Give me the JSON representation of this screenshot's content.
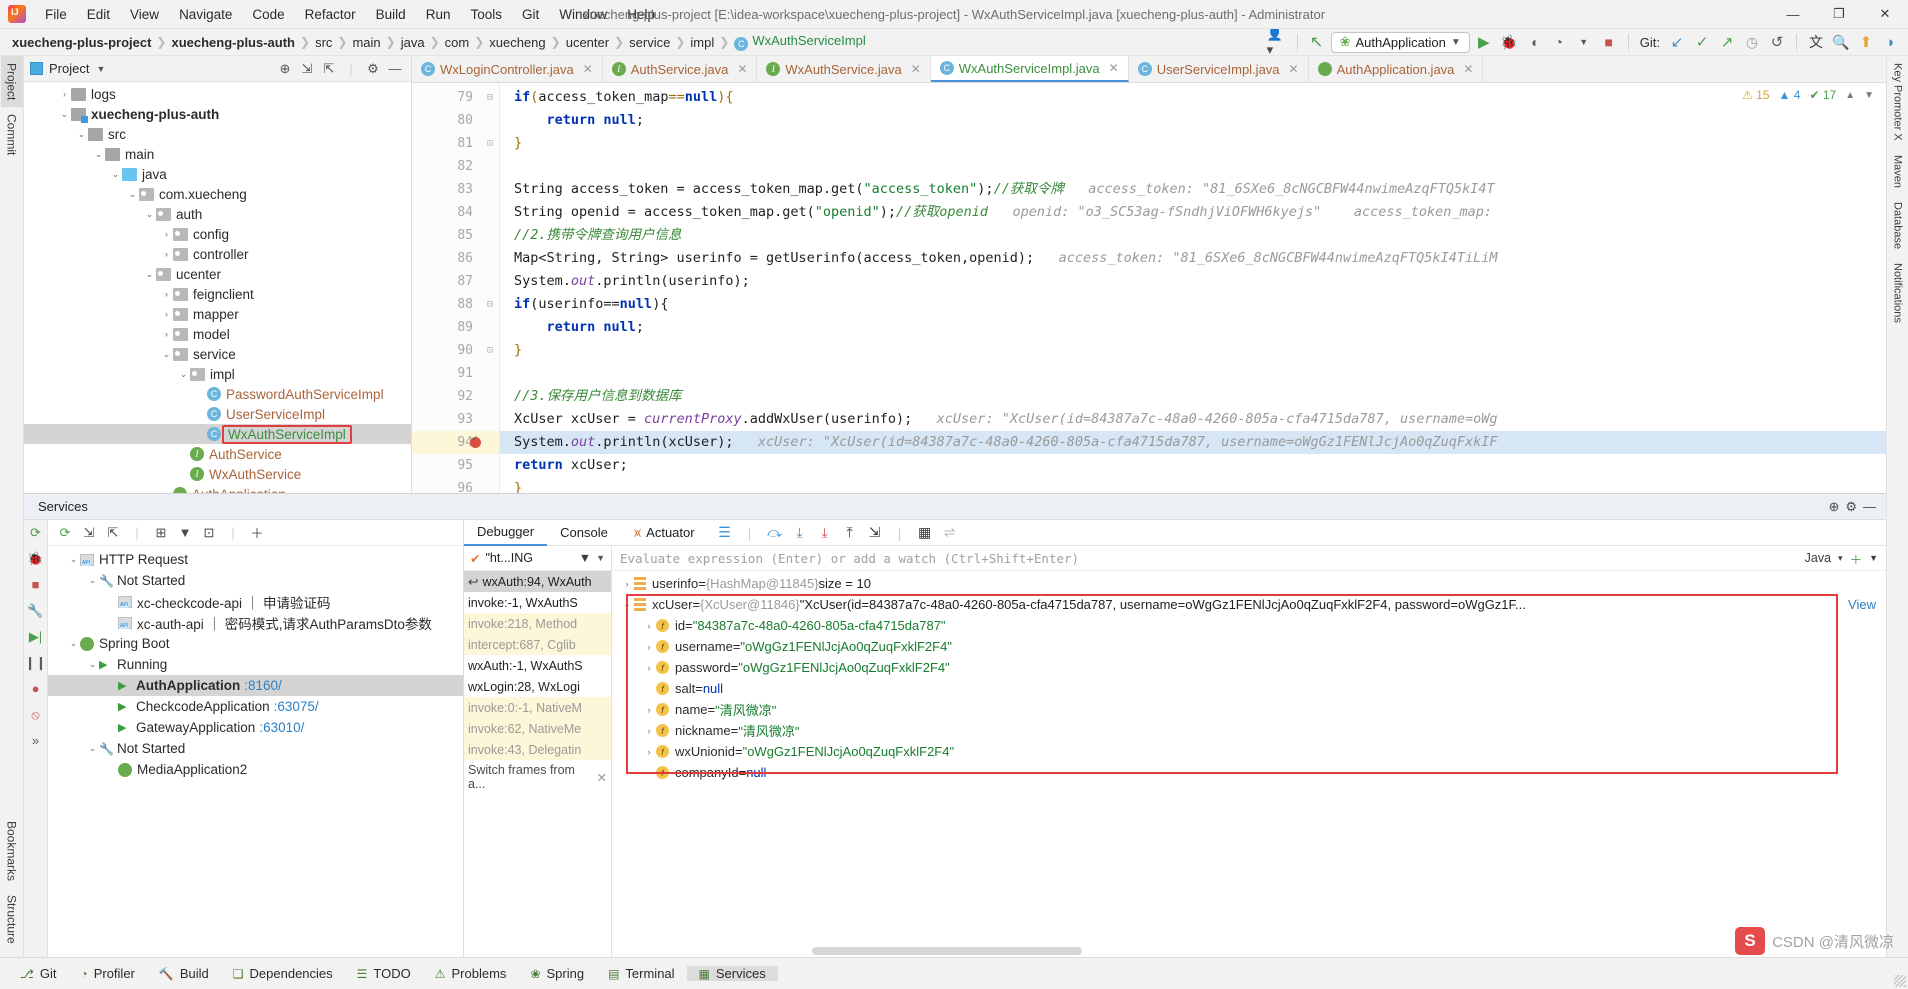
{
  "window": {
    "title": "xuecheng-plus-project [E:\\idea-workspace\\xuecheng-plus-project] - WxAuthServiceImpl.java [xuecheng-plus-auth] - Administrator",
    "minimize": "—",
    "maximize": "❐",
    "close": "✕"
  },
  "menu": [
    "File",
    "Edit",
    "View",
    "Navigate",
    "Code",
    "Refactor",
    "Build",
    "Run",
    "Tools",
    "Git",
    "Window",
    "Help"
  ],
  "breadcrumbs": [
    "xuecheng-plus-project",
    "xuecheng-plus-auth",
    "src",
    "main",
    "java",
    "com",
    "xuecheng",
    "ucenter",
    "service",
    "impl",
    "WxAuthServiceImpl"
  ],
  "toolbar": {
    "run_config": "AuthApplication",
    "git_label": "Git:",
    "icons": [
      "profile-icon",
      "back-icon",
      "run-icon",
      "debug-icon",
      "run-coverage-icon",
      "profiler-icon",
      "stop-icon",
      "update-project-icon",
      "commit-icon",
      "push-icon",
      "history-icon",
      "rollback-icon",
      "translate-icon",
      "search-everywhere-icon",
      "updates-icon",
      "ide-icon"
    ]
  },
  "left_rail": [
    "Project",
    "Commit"
  ],
  "left_rail_bottom": [
    "Bookmarks",
    "Structure"
  ],
  "right_rail": [
    "Key Promoter X",
    "Maven",
    "Database",
    "Notifications"
  ],
  "project": {
    "title": "Project",
    "tree": [
      {
        "label": "logs",
        "indent": 2,
        "arrow": "›",
        "icon": "folder",
        "style": "",
        "cut": true
      },
      {
        "label": "xuecheng-plus-auth",
        "indent": 2,
        "arrow": "⌄",
        "icon": "module",
        "style": "bold"
      },
      {
        "label": "src",
        "indent": 3,
        "arrow": "⌄",
        "icon": "folder",
        "style": ""
      },
      {
        "label": "main",
        "indent": 4,
        "arrow": "⌄",
        "icon": "folder",
        "style": ""
      },
      {
        "label": "java",
        "indent": 5,
        "arrow": "⌄",
        "icon": "source",
        "style": ""
      },
      {
        "label": "com.xuecheng",
        "indent": 6,
        "arrow": "⌄",
        "icon": "package",
        "style": ""
      },
      {
        "label": "auth",
        "indent": 7,
        "arrow": "⌄",
        "icon": "package",
        "style": ""
      },
      {
        "label": "config",
        "indent": 8,
        "arrow": "›",
        "icon": "package",
        "style": ""
      },
      {
        "label": "controller",
        "indent": 8,
        "arrow": "›",
        "icon": "package",
        "style": ""
      },
      {
        "label": "ucenter",
        "indent": 7,
        "arrow": "⌄",
        "icon": "package",
        "style": ""
      },
      {
        "label": "feignclient",
        "indent": 8,
        "arrow": "›",
        "icon": "package",
        "style": ""
      },
      {
        "label": "mapper",
        "indent": 8,
        "arrow": "›",
        "icon": "package",
        "style": ""
      },
      {
        "label": "model",
        "indent": 8,
        "arrow": "›",
        "icon": "package",
        "style": ""
      },
      {
        "label": "service",
        "indent": 8,
        "arrow": "⌄",
        "icon": "package",
        "style": ""
      },
      {
        "label": "impl",
        "indent": 9,
        "arrow": "⌄",
        "icon": "package",
        "style": ""
      },
      {
        "label": "PasswordAuthServiceImpl",
        "indent": 10,
        "arrow": "",
        "icon": "class",
        "style": "brown"
      },
      {
        "label": "UserServiceImpl",
        "indent": 10,
        "arrow": "",
        "icon": "class",
        "style": "brown"
      },
      {
        "label": "WxAuthServiceImpl",
        "indent": 10,
        "arrow": "",
        "icon": "class",
        "style": "green",
        "selected": true,
        "highlighted": true
      },
      {
        "label": "AuthService",
        "indent": 9,
        "arrow": "",
        "icon": "interface",
        "style": "brown"
      },
      {
        "label": "WxAuthService",
        "indent": 9,
        "arrow": "",
        "icon": "interface",
        "style": "brown"
      },
      {
        "label": "AuthApplication",
        "indent": 8,
        "arrow": "",
        "icon": "spring",
        "style": "brown",
        "cut": true
      }
    ]
  },
  "editor": {
    "tabs": [
      {
        "label": "WxLoginController.java",
        "icon": "class-icon",
        "color": "brown",
        "active": false
      },
      {
        "label": "AuthService.java",
        "icon": "interface-icon",
        "color": "brown",
        "active": false
      },
      {
        "label": "WxAuthService.java",
        "icon": "interface-icon",
        "color": "brown",
        "active": false
      },
      {
        "label": "WxAuthServiceImpl.java",
        "icon": "class-icon",
        "color": "green",
        "active": true
      },
      {
        "label": "UserServiceImpl.java",
        "icon": "class-icon",
        "color": "brown",
        "active": false
      },
      {
        "label": "AuthApplication.java",
        "icon": "spring-icon",
        "color": "brown",
        "active": false
      }
    ],
    "inspections": {
      "warnings": "15",
      "errors": "4",
      "checks": "17"
    },
    "lines": [
      {
        "n": "79",
        "fold": "⊟",
        "html": "<span class=\"k\">if</span><span class=\"pl\">(</span>access_token_map<span class=\"pl\">==</span><span class=\"k\">null</span><span class=\"pl\">){</span>"
      },
      {
        "n": "80",
        "fold": "",
        "html": "    <span class=\"k\">return null</span>;"
      },
      {
        "n": "81",
        "fold": "⊡",
        "html": "<span class=\"pl\">}</span>"
      },
      {
        "n": "82",
        "fold": "",
        "html": ""
      },
      {
        "n": "83",
        "fold": "",
        "html": "<span class=\"fn\">String access_token = access_token_map.</span><span class=\"fn\">get(</span><span class=\"s\">\"access_token\"</span><span class=\"fn\">);</span><span class=\"cm\">//获取令牌</span>   <span class=\"hint\">access_token: \"81_6SXe6_8cNGCBFW44nwimeAzqFTQ5kI4T</span>"
      },
      {
        "n": "84",
        "fold": "",
        "html": "<span class=\"fn\">String openid = access_token_map.get(</span><span class=\"s\">\"openid\"</span><span class=\"fn\">);</span><span class=\"cm\">//获取openid</span>   <span class=\"hint\">openid: \"o3_SC53ag-fSndhjViOFWH6kyejs\"</span>    <span class=\"hint\">access_token_map:</span>"
      },
      {
        "n": "85",
        "fold": "",
        "html": "<span class=\"cm\">//2.携带令牌查询用户信息</span>"
      },
      {
        "n": "86",
        "fold": "",
        "html": "<span class=\"fn\">Map&lt;String, String&gt; userinfo = getUserinfo(access_token,openid);</span>   <span class=\"hint\">access_token: \"81_6SXe6_8cNGCBFW44nwimeAzqFTQ5kI4TiLiM</span>"
      },
      {
        "n": "87",
        "fold": "",
        "html": "<span class=\"fn\">System.</span><span class=\"stat\">out</span><span class=\"fn\">.println(userinfo);</span>"
      },
      {
        "n": "88",
        "fold": "⊟",
        "html": "<span class=\"k\">if</span><span class=\"fn\">(userinfo==</span><span class=\"k\">null</span><span class=\"fn\">){</span>"
      },
      {
        "n": "89",
        "fold": "",
        "html": "    <span class=\"k\">return null</span>;"
      },
      {
        "n": "90",
        "fold": "⊡",
        "html": "<span class=\"pl\">}</span>"
      },
      {
        "n": "91",
        "fold": "",
        "html": ""
      },
      {
        "n": "92",
        "fold": "",
        "html": "<span class=\"cm\">//3.保存用户信息到数据库</span>"
      },
      {
        "n": "93",
        "fold": "",
        "html": "<span class=\"fn\">XcUser xcUser = </span><span class=\"stat\">currentProxy</span><span class=\"fn\">.addWxUser(userinfo);</span>   <span class=\"hint\">xcUser: \"XcUser(id=84387a7c-48a0-4260-805a-cfa4715da787, username=oWg</span>"
      },
      {
        "n": "94",
        "fold": "",
        "breakpoint": true,
        "highlight": true,
        "html": "<span class=\"fn\">System.</span><span class=\"stat\">out</span><span class=\"fn\">.println(xcUser);</span>   <span class=\"hint\">xcUser: \"XcUser(id=84387a7c-48a0-4260-805a-cfa4715da787, username=oWgGz1FENlJcjAo0qZuqFxkIF</span>"
      },
      {
        "n": "95",
        "fold": "",
        "html": "<span class=\"k\">return</span><span class=\"fn\"> xcUser;</span>"
      },
      {
        "n": "96",
        "fold": "",
        "html": "<span class=\"pl\">}</span>"
      }
    ]
  },
  "services": {
    "title": "Services",
    "tree": [
      {
        "label": "HTTP Request",
        "indent": 1,
        "arrow": "⌄",
        "icon": "api"
      },
      {
        "label": "Not Started",
        "indent": 2,
        "arrow": "⌄",
        "icon": "wrench"
      },
      {
        "label": "xc-checkcode-api ｜ 申请验证码",
        "indent": 3,
        "arrow": "",
        "icon": "api"
      },
      {
        "label": "xc-auth-api ｜ 密码模式,请求AuthParamsDto参数",
        "indent": 3,
        "arrow": "",
        "icon": "api"
      },
      {
        "label": "Spring Boot",
        "indent": 1,
        "arrow": "⌄",
        "icon": "spring"
      },
      {
        "label": "Running",
        "indent": 2,
        "arrow": "⌄",
        "icon": "play"
      },
      {
        "label": "AuthApplication",
        "sublabel": ":8160/",
        "indent": 3,
        "arrow": "",
        "icon": "play",
        "bold": true,
        "selected": true
      },
      {
        "label": "CheckcodeApplication",
        "sublabel": ":63075/",
        "indent": 3,
        "arrow": "",
        "icon": "play"
      },
      {
        "label": "GatewayApplication",
        "sublabel": ":63010/",
        "indent": 3,
        "arrow": "",
        "icon": "play"
      },
      {
        "label": "Not Started",
        "indent": 2,
        "arrow": "⌄",
        "icon": "wrench"
      },
      {
        "label": "MediaApplication2",
        "indent": 3,
        "arrow": "",
        "icon": "spring"
      }
    ]
  },
  "debugger": {
    "tabs": [
      "Debugger",
      "Console"
    ],
    "actuator_label": "Actuator",
    "active_tab": "Debugger",
    "frames_filter": "\"ht...ING",
    "frames": [
      {
        "text": "wxAuth:94, WxAuth",
        "state": "sel"
      },
      {
        "text": "invoke:-1, WxAuthS",
        "state": ""
      },
      {
        "text": "invoke:218, Method",
        "state": "lib"
      },
      {
        "text": "intercept:687, Cglib",
        "state": "lib"
      },
      {
        "text": "wxAuth:-1, WxAuthS",
        "state": ""
      },
      {
        "text": "wxLogin:28, WxLogi",
        "state": ""
      },
      {
        "text": "invoke:0:-1, NativeM",
        "state": "lib"
      },
      {
        "text": "invoke:62, NativeMe",
        "state": "lib"
      },
      {
        "text": "invoke:43, Delegatin",
        "state": "lib"
      }
    ],
    "switch_frames": "Switch frames from a...",
    "evaluate_placeholder": "Evaluate expression (Enter) or add a watch (Ctrl+Shift+Enter)",
    "language": "Java",
    "variables": [
      {
        "arrow": "›",
        "icon": "obj",
        "name": "userinfo",
        "eq": " = ",
        "type": "{HashMap@11845}",
        "value": " size = 10",
        "indent": 0,
        "boxed": false
      },
      {
        "arrow": "⌄",
        "icon": "obj",
        "name": "xcUser",
        "eq": " = ",
        "type": "{XcUser@11846}",
        "value": " \"XcUser(id=84387a7c-48a0-4260-805a-cfa4715da787, username=oWgGz1FENlJcjAo0qZuqFxklF2F4, password=oWgGz1F...",
        "link": "View",
        "indent": 0,
        "boxed": true
      },
      {
        "arrow": "›",
        "icon": "fld",
        "name": "id",
        "eq": " = ",
        "str": "\"84387a7c-48a0-4260-805a-cfa4715da787\"",
        "indent": 1,
        "boxed": true
      },
      {
        "arrow": "›",
        "icon": "fld",
        "name": "username",
        "eq": " = ",
        "str": "\"oWgGz1FENlJcjAo0qZuqFxklF2F4\"",
        "indent": 1,
        "boxed": true
      },
      {
        "arrow": "›",
        "icon": "fld",
        "name": "password",
        "eq": " = ",
        "str": "\"oWgGz1FENlJcjAo0qZuqFxklF2F4\"",
        "indent": 1,
        "boxed": true
      },
      {
        "arrow": "",
        "icon": "fld",
        "name": "salt",
        "eq": " = ",
        "nul": "null",
        "indent": 1,
        "boxed": true
      },
      {
        "arrow": "›",
        "icon": "fld",
        "name": "name",
        "eq": " = ",
        "str": "\"清风微凉\"",
        "indent": 1,
        "boxed": true
      },
      {
        "arrow": "›",
        "icon": "fld",
        "name": "nickname",
        "eq": " = ",
        "str": "\"清风微凉\"",
        "indent": 1,
        "boxed": true
      },
      {
        "arrow": "›",
        "icon": "fld",
        "name": "wxUnionid",
        "eq": " = ",
        "str": "\"oWgGz1FENlJcjAo0qZuqFxklF2F4\"",
        "indent": 1,
        "boxed": true
      },
      {
        "arrow": "",
        "icon": "fld",
        "name": "companyId",
        "eq": " = ",
        "nul": "null",
        "indent": 1,
        "boxed": true
      }
    ]
  },
  "status_bar": [
    {
      "label": "Git",
      "icon": "git-icon"
    },
    {
      "label": "Profiler",
      "icon": "profiler-icon"
    },
    {
      "label": "Build",
      "icon": "build-icon"
    },
    {
      "label": "Dependencies",
      "icon": "dependencies-icon"
    },
    {
      "label": "TODO",
      "icon": "todo-icon"
    },
    {
      "label": "Problems",
      "icon": "problems-icon"
    },
    {
      "label": "Spring",
      "icon": "spring-icon"
    },
    {
      "label": "Terminal",
      "icon": "terminal-icon"
    },
    {
      "label": "Services",
      "icon": "services-icon",
      "active": true
    }
  ],
  "watermark": {
    "logo": "S",
    "text": "CSDN @清风微凉"
  }
}
